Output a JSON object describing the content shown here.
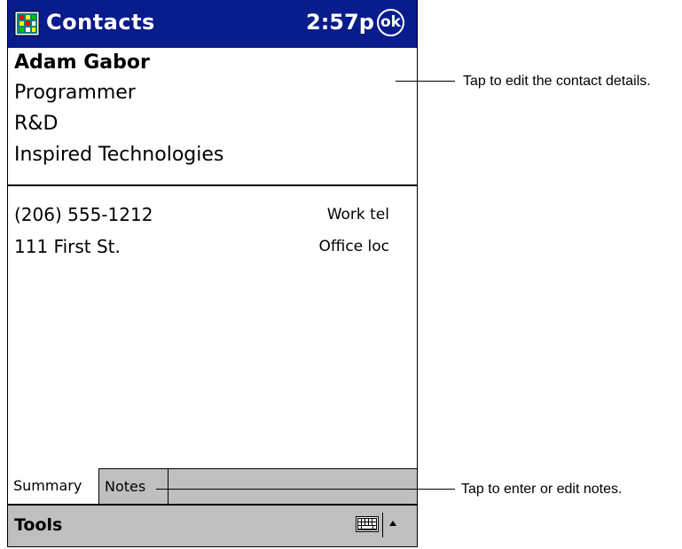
{
  "titlebar": {
    "app_title": "Contacts",
    "clock": "2:57p",
    "ok_label": "ok",
    "icon": "contacts-app-icon",
    "color": "#081c8b"
  },
  "contact": {
    "name": "Adam Gabor",
    "title": "Programmer",
    "department": "R&D",
    "company": "Inspired Technologies"
  },
  "details": [
    {
      "value": "(206) 555-1212",
      "label": "Work tel"
    },
    {
      "value": "111 First St.",
      "label": "Office loc"
    }
  ],
  "tabs": [
    {
      "label": "Summary",
      "selected": true
    },
    {
      "label": "Notes",
      "selected": false
    }
  ],
  "menubar": {
    "tools_label": "Tools",
    "keyboard_icon": "keyboard-icon",
    "sip_arrow_icon": "sip-arrow-up-icon"
  },
  "callouts": {
    "details": "Tap to edit the contact details.",
    "notes": "Tap to enter or edit notes."
  }
}
